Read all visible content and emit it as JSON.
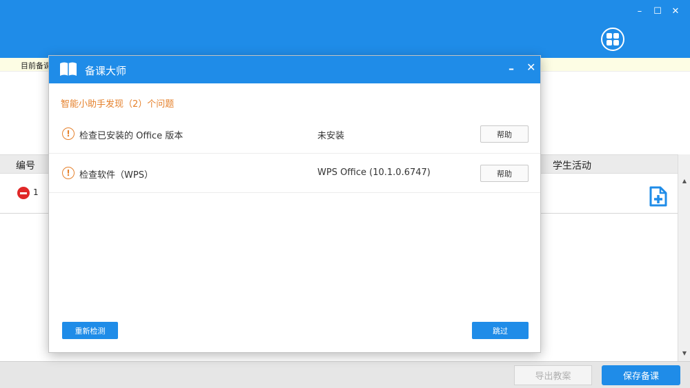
{
  "main": {
    "notice_text": "目前备课",
    "table": {
      "col_number": "编号",
      "col_activity": "学生活动",
      "rows": [
        {
          "number": "1"
        }
      ]
    },
    "window_controls": {
      "minimize": "–",
      "maximize": "☐",
      "close": "✕"
    },
    "footer": {
      "export_label": "导出教案",
      "save_label": "保存备课"
    }
  },
  "dialog": {
    "title": "备课大师",
    "controls": {
      "minimize": "–",
      "close": "✕"
    },
    "summary": "智能小助手发现（2）个问题",
    "checks": [
      {
        "label": "检查已安装的 Office 版本",
        "status": "未安装",
        "help_label": "帮助"
      },
      {
        "label": "检查软件（WPS）",
        "status": "WPS Office (10.1.0.6747)",
        "help_label": "帮助"
      }
    ],
    "recheck_label": "重新检测",
    "skip_label": "跳过"
  },
  "colors": {
    "primary": "#1f8ce8",
    "warning": "#e5812c",
    "danger": "#e02828",
    "notice_bg": "#fdfde4"
  },
  "icons": {
    "warning": "warning-circle-icon",
    "book": "book-icon",
    "grid": "grid-menu-icon",
    "remove": "remove-circle-icon",
    "add_file": "add-file-icon"
  }
}
